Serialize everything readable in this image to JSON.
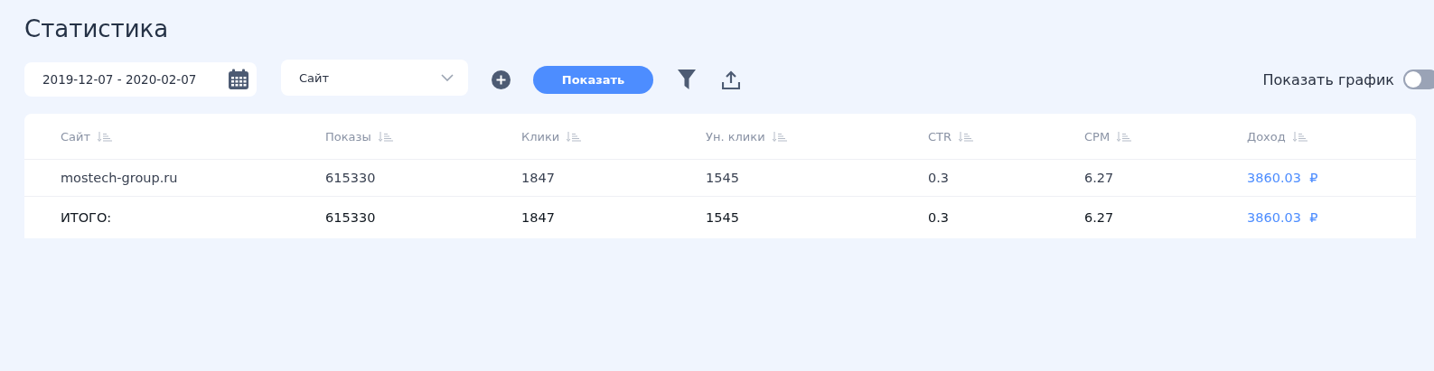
{
  "title": "Статистика",
  "toolbar": {
    "date_range": {
      "value": "2019-12-07 - 2020-02-07"
    },
    "site_select": {
      "value": "Сайт"
    },
    "show_button": "Показать",
    "chart_toggle": {
      "label": "Показать график",
      "on": false
    }
  },
  "table": {
    "columns": [
      "Сайт",
      "Показы",
      "Клики",
      "Ун. клики",
      "CTR",
      "CPM",
      "Доход"
    ],
    "rows": [
      {
        "kind": "row",
        "cells": [
          "mostech-group.ru",
          "615330",
          "1847",
          "1545",
          "0.3",
          "6.27",
          "3860.03  ₽"
        ]
      },
      {
        "kind": "total",
        "cells": [
          "ИТОГО:",
          "615330",
          "1847",
          "1545",
          "0.3",
          "6.27",
          "3860.03  ₽"
        ]
      }
    ]
  }
}
